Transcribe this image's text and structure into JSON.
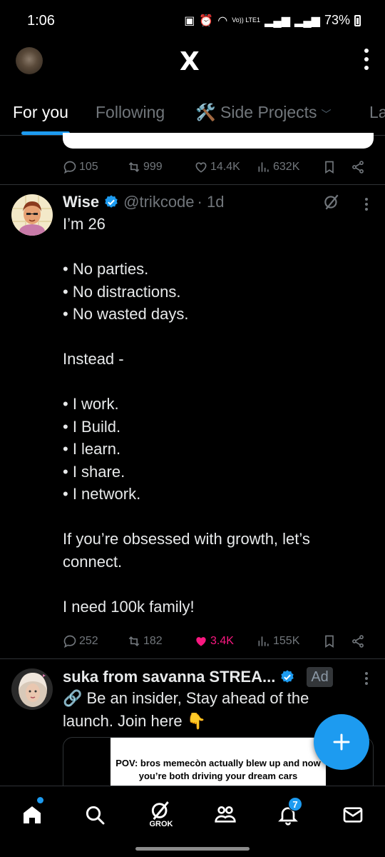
{
  "status_bar": {
    "time": "1:06",
    "signal_text": "Vo)) LTE1",
    "battery": "73%"
  },
  "header": {
    "logo": "X"
  },
  "tabs": [
    {
      "label": "For you",
      "active": true
    },
    {
      "label": "Following",
      "active": false
    },
    {
      "label": "🛠️ Side Projects",
      "active": false
    },
    {
      "label": "La",
      "active": false
    }
  ],
  "prev_post": {
    "replies": "105",
    "reposts": "999",
    "likes": "14.4K",
    "views": "632K"
  },
  "tweet": {
    "name": "Wise",
    "handle": "@trikcode",
    "time": "· 1d",
    "lines": [
      "I’m 26",
      "",
      "• No parties.",
      "• No distractions.",
      "• No wasted days.",
      "",
      "Instead -",
      "",
      "• I work.",
      "• I Build.",
      "• I learn.",
      "• I share.",
      "• I network.",
      "",
      "If you’re obsessed with growth, let’s",
      "connect.",
      "",
      "I need 100k family!"
    ],
    "replies": "252",
    "reposts": "182",
    "likes": "3.4K",
    "views": "155K",
    "like_color": "#f91880"
  },
  "ad": {
    "name": "suka from savanna STREA...",
    "badge": "Ad",
    "lines": [
      "🔗 Be an insider, Stay ahead of the",
      "launch. Join here 👇"
    ],
    "media_caption": "POV: bros memecòn  actually blew up and now you’re both driving your dream cars"
  },
  "bottom_nav": {
    "grok_label": "GROK",
    "notifications_count": "7"
  },
  "colors": {
    "accent": "#1d9bf0",
    "muted": "#71767b",
    "like": "#f91880"
  }
}
